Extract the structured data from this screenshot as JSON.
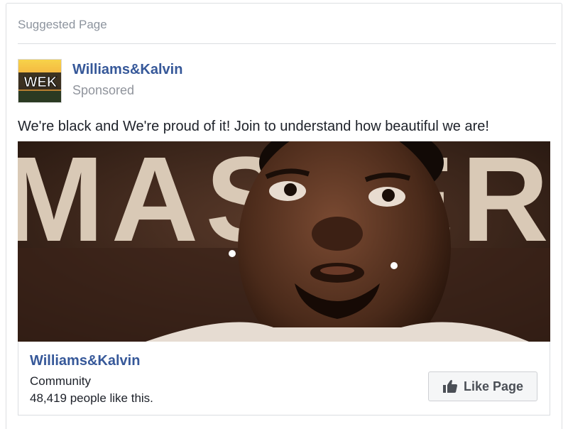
{
  "header": {
    "label": "Suggested Page"
  },
  "post": {
    "page_name": "Williams&Kalvin",
    "avatar_text": "WEK",
    "sponsored_label": "Sponsored",
    "message": "We're black and We're proud of it! Join to understand how beautiful we are!",
    "image_sign_text": "MASTER"
  },
  "attachment": {
    "title": "Williams&Kalvin",
    "category": "Community",
    "likes_text": "48,419 people like this.",
    "like_button_label": "Like Page",
    "like_icon": "thumbs-up-icon"
  },
  "colors": {
    "link": "#365899",
    "muted": "#90949c",
    "text": "#1d2129",
    "button_bg": "#f5f6f7"
  }
}
